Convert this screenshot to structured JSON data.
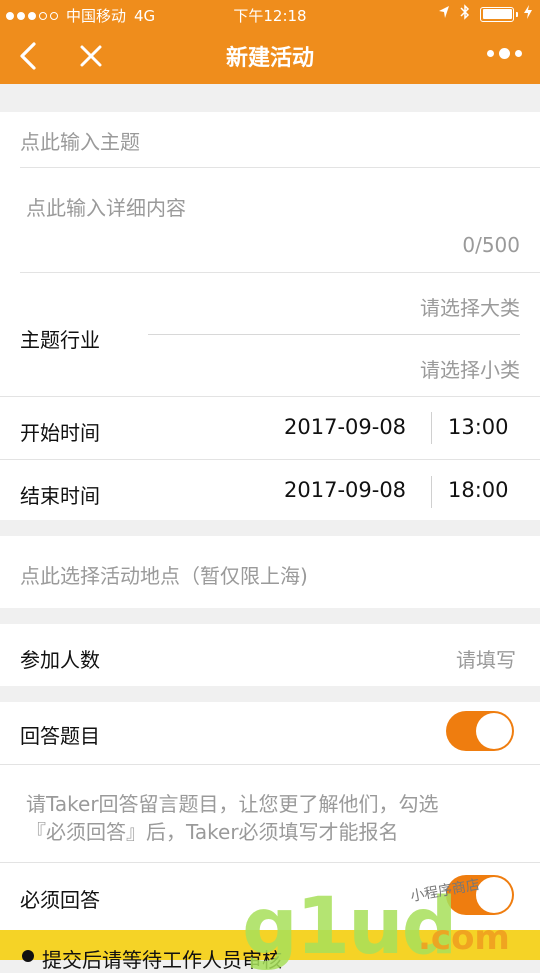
{
  "status": {
    "carrier": "中国移动",
    "network": "4G",
    "time": "下午12:18"
  },
  "nav": {
    "title": "新建活动"
  },
  "form": {
    "subject_placeholder": "点此输入主题",
    "detail_placeholder": "点此输入详细内容",
    "detail_counter": "0/500",
    "industry_label": "主题行业",
    "industry_major_placeholder": "请选择大类",
    "industry_minor_placeholder": "请选择小类",
    "start_label": "开始时间",
    "start_date": "2017-09-08",
    "start_time": "13:00",
    "end_label": "结束时间",
    "end_date": "2017-09-08",
    "end_time": "18:00",
    "location_placeholder": "点此选择活动地点（暂仅限上海)",
    "participants_label": "参加人数",
    "participants_placeholder": "请填写",
    "answer_label": "回答题目",
    "answer_toggle_on": true,
    "answer_hint_line1": "请Taker回答留言题目，让您更了解他们，勾选",
    "answer_hint_line2": "『必须回答』后，Taker必须填写才能报名",
    "required_label": "必须回答",
    "required_toggle_on": true
  },
  "footer": {
    "notice": "提交后请等待工作人员审核"
  },
  "watermark": {
    "main": "g1ud",
    "suffix": ".com",
    "small": "小程序商店"
  },
  "colors": {
    "brand": "#ef8d1c",
    "toggle": "#ef7d0f",
    "footer": "#f5d326"
  }
}
